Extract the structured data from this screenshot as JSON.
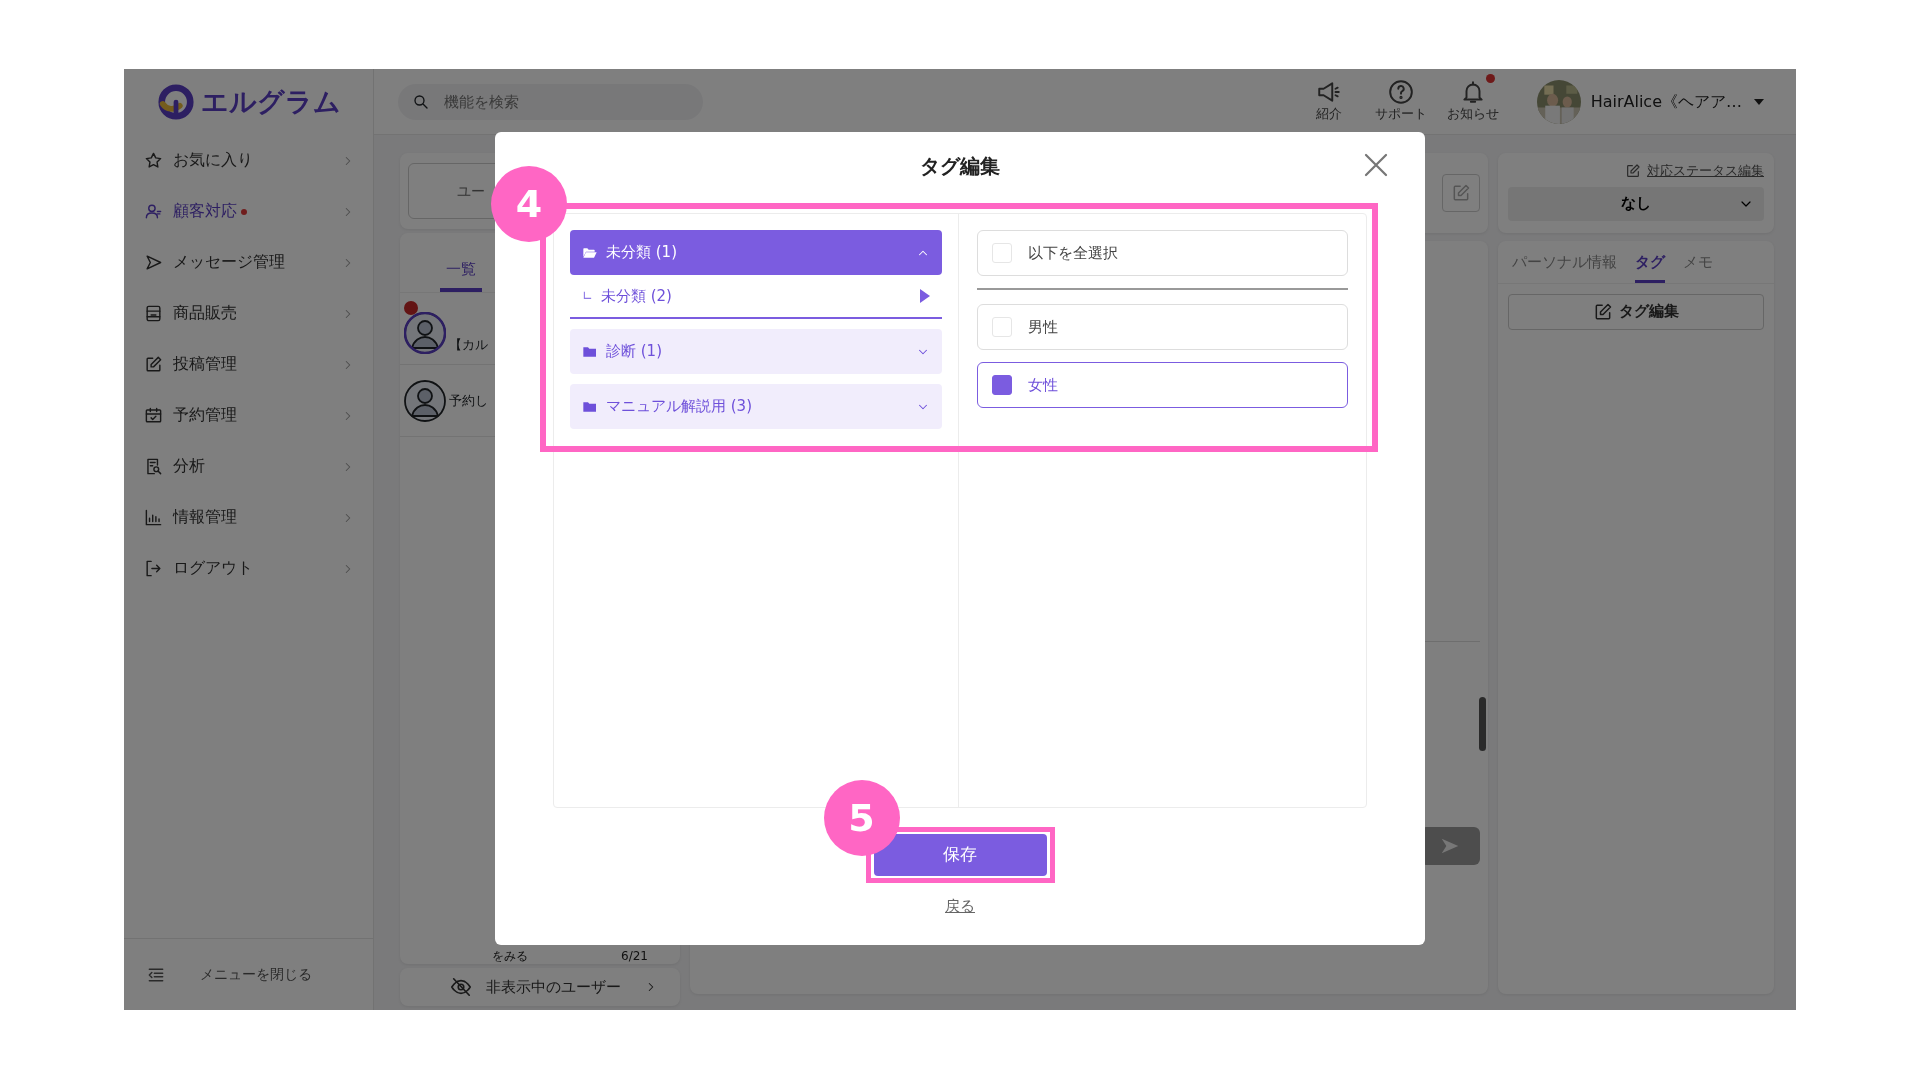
{
  "app": {
    "logo": "エルグラム",
    "search": {
      "placeholder": "機能を検索"
    },
    "header_actions": [
      {
        "label": "紹介",
        "kind": "megaphone",
        "badge": false
      },
      {
        "label": "サポート",
        "kind": "help",
        "badge": false
      },
      {
        "label": "お知らせ",
        "kind": "bell",
        "badge": true
      }
    ],
    "account": {
      "name": "HairAlice《ヘアア…"
    }
  },
  "sidebar": {
    "items": [
      {
        "label": "お気に入り",
        "kind": "star",
        "selected": false,
        "dot": false
      },
      {
        "label": "顧客対応",
        "kind": "person",
        "selected": true,
        "dot": true
      },
      {
        "label": "メッセージ管理",
        "kind": "send",
        "selected": false,
        "dot": false
      },
      {
        "label": "商品販売",
        "kind": "register",
        "selected": false,
        "dot": false
      },
      {
        "label": "投稿管理",
        "kind": "edit",
        "selected": false,
        "dot": false
      },
      {
        "label": "予約管理",
        "kind": "calendar",
        "selected": false,
        "dot": false
      },
      {
        "label": "分析",
        "kind": "report",
        "selected": false,
        "dot": false
      },
      {
        "label": "情報管理",
        "kind": "chart",
        "selected": false,
        "dot": false
      },
      {
        "label": "ログアウト",
        "kind": "logout",
        "selected": false,
        "dot": false
      }
    ],
    "collapse_label": "メニューを閉じる"
  },
  "user_list": {
    "filter_button": "ユー",
    "tabs": [
      {
        "label": "一覧",
        "selected": true
      }
    ],
    "rows": [
      {
        "preview": "【カル",
        "unread": true
      },
      {
        "preview": "予約し",
        "unread": false
      }
    ],
    "last_row": {
      "preview": "をみる",
      "date": "6/21"
    },
    "hidden_users": "非表示中のユーザー"
  },
  "detail": {
    "status_link": "対応ステータス編集",
    "status_value": "なし",
    "tabs": [
      {
        "label": "パーソナル情報",
        "selected": false
      },
      {
        "label": "タグ",
        "selected": true
      },
      {
        "label": "メモ",
        "selected": false
      }
    ],
    "tag_edit_button": "タグ編集"
  },
  "modal": {
    "title": "タグ編集",
    "folders": [
      {
        "label": "未分類 (1)",
        "expanded": true,
        "children": [
          {
            "prefix": "∟",
            "label": "未分類 (2)",
            "selected": true
          }
        ]
      },
      {
        "label": "診断 (1)",
        "expanded": false
      },
      {
        "label": "マニュアル解説用 (3)",
        "expanded": false
      }
    ],
    "select_all": {
      "label": "以下を全選択",
      "checked": false
    },
    "tags": [
      {
        "label": "男性",
        "checked": false
      },
      {
        "label": "女性",
        "checked": true
      }
    ],
    "save_button": "保存",
    "back_link": "戻る"
  },
  "annotations": [
    {
      "label": "4"
    },
    {
      "label": "5"
    }
  ]
}
